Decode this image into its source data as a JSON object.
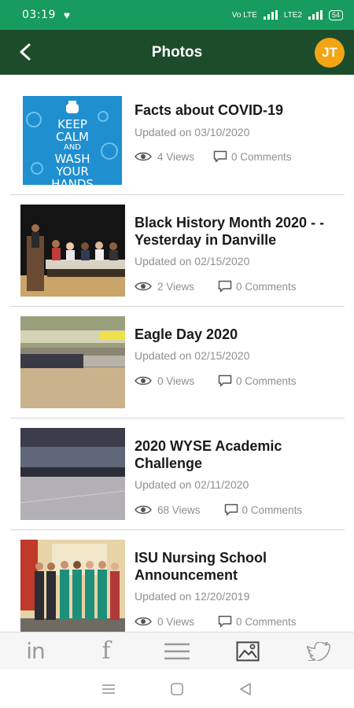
{
  "status_bar": {
    "time": "03:19",
    "network": "Vo LTE",
    "network2": "LTE2",
    "battery": "54"
  },
  "app_bar": {
    "title": "Photos",
    "avatar_initials": "JT",
    "colors": {
      "bar": "#1d4c2b",
      "status": "#179b5e",
      "avatar": "#f3a516"
    }
  },
  "photos": [
    {
      "title": "Facts about COVID-19",
      "updated": "Updated on 03/10/2020",
      "views": "4 Views",
      "comments": "0 Comments",
      "poster_lines": [
        "KEEP",
        "CALM",
        "AND",
        "WASH",
        "YOUR",
        "HANDS"
      ]
    },
    {
      "title": "Black History Month 2020 - - Yesterday in Danville",
      "updated": "Updated on 02/15/2020",
      "views": "2 Views",
      "comments": "0 Comments"
    },
    {
      "title": "Eagle Day 2020",
      "updated": "Updated on 02/15/2020",
      "views": "0 Views",
      "comments": "0 Comments"
    },
    {
      "title": "2020 WYSE Academic Challenge",
      "updated": "Updated on 02/11/2020",
      "views": "68 Views",
      "comments": "0 Comments"
    },
    {
      "title": "ISU Nursing School Announcement",
      "updated": "Updated on 12/20/2019",
      "views": "0 Views",
      "comments": "0 Comments"
    }
  ],
  "bottom_nav": {
    "items": [
      "linkedin-icon",
      "facebook-icon",
      "menu-icon",
      "photos-icon",
      "twitter-icon"
    ],
    "linkedin_label": "in",
    "facebook_label": "f"
  }
}
